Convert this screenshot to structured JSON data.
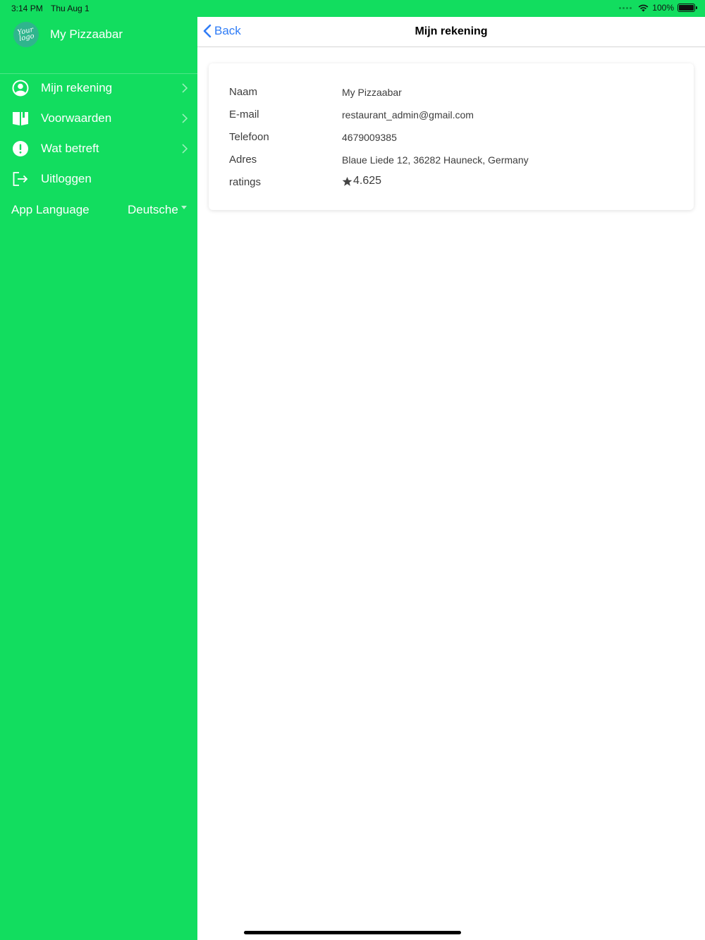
{
  "status_bar": {
    "time": "3:14 PM",
    "date": "Thu Aug 1",
    "battery": "100%"
  },
  "sidebar": {
    "logo_text": "Your logo",
    "brand_name": "My Pizzaabar",
    "items": [
      {
        "label": "Mijn rekening",
        "icon": "user-circle-icon",
        "chevron": true
      },
      {
        "label": "Voorwaarden",
        "icon": "book-icon",
        "chevron": true
      },
      {
        "label": "Wat betreft",
        "icon": "info-circle-icon",
        "chevron": true
      },
      {
        "label": "Uitloggen",
        "icon": "logout-icon",
        "chevron": false
      }
    ],
    "language": {
      "label": "App Language",
      "value": "Deutsche"
    }
  },
  "header": {
    "back_label": "Back",
    "title": "Mijn rekening"
  },
  "account": {
    "fields": [
      {
        "key": "Naam",
        "value": "My Pizzaabar"
      },
      {
        "key": "E-mail",
        "value": "restaurant_admin@gmail.com"
      },
      {
        "key": "Telefoon",
        "value": "4679009385"
      },
      {
        "key": "Adres",
        "value": "Blaue Liede 12, 36282 Hauneck, Germany"
      },
      {
        "key": "ratings",
        "value": "4.625"
      }
    ]
  },
  "colors": {
    "sidebar_bg": "#12dd5f",
    "accent_link": "#2f7cf6",
    "logo_bg": "#2fb58d"
  }
}
